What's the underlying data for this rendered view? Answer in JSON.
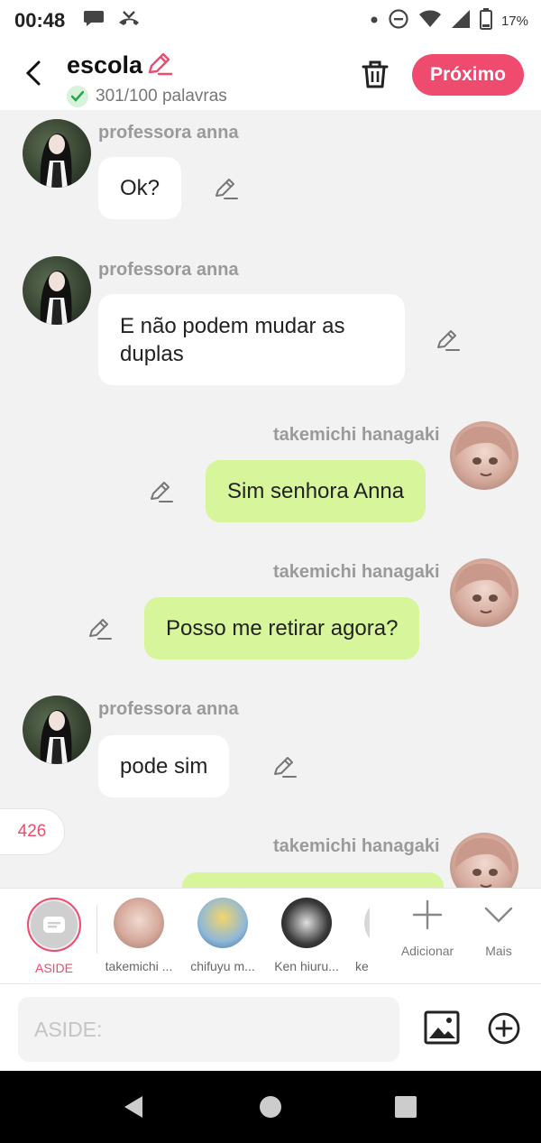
{
  "status_bar": {
    "time": "00:48",
    "battery": "17%"
  },
  "header": {
    "title": "escola",
    "word_count": "301/100 palavras",
    "next_label": "Próximo"
  },
  "messages": [
    {
      "side": "left",
      "name": "professora anna",
      "text": "Ok?"
    },
    {
      "side": "left",
      "name": "professora anna",
      "text": "E não podem mudar as duplas"
    },
    {
      "side": "right",
      "name": "takemichi hanagaki",
      "text": "Sim senhora Anna"
    },
    {
      "side": "right",
      "name": "takemichi hanagaki",
      "text": "Posso me retirar agora?"
    },
    {
      "side": "left",
      "name": "professora anna",
      "text": "pode sim"
    },
    {
      "side": "right",
      "name": "takemichi hanagaki",
      "text": ""
    }
  ],
  "counter": "426",
  "characters": {
    "aside": "ASIDE",
    "items": [
      {
        "label": "takemichi ..."
      },
      {
        "label": "chifuyu m..."
      },
      {
        "label": "Ken hiuru..."
      },
      {
        "label": "ke"
      }
    ],
    "add_label": "Adicionar",
    "more_label": "Mais"
  },
  "input": {
    "placeholder": "ASIDE:"
  },
  "colors": {
    "accent": "#ee4b6e",
    "bubble_right": "#d7f59a",
    "bubble_left": "#ffffff",
    "background": "#f2f2f2"
  }
}
